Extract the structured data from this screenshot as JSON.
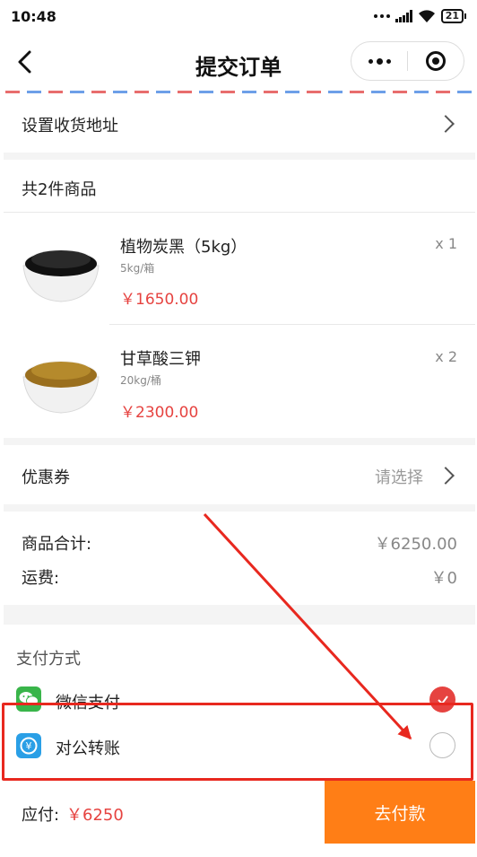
{
  "status_bar": {
    "time": "10:48",
    "battery": "21"
  },
  "navbar": {
    "title": "提交订单"
  },
  "address": {
    "label": "设置收货地址"
  },
  "items_header": {
    "label": "共2件商品"
  },
  "items": [
    {
      "name": "植物炭黑（5kg）",
      "spec": "5kg/箱",
      "price": "￥1650.00",
      "qty": "x 1"
    },
    {
      "name": "甘草酸三钾",
      "spec": "20kg/桶",
      "price": "￥2300.00",
      "qty": "x 2"
    }
  ],
  "coupon": {
    "label": "优惠券",
    "placeholder": "请选择"
  },
  "summary": {
    "goods_label": "商品合计:",
    "goods_value": "￥6250.00",
    "shipping_label": "运费:",
    "shipping_value": "￥0"
  },
  "payment": {
    "heading": "支付方式",
    "methods": [
      {
        "label": "微信支付",
        "selected": true
      },
      {
        "label": "对公转账",
        "selected": false
      }
    ]
  },
  "footer": {
    "due_label": "应付:",
    "due_value": "￥6250",
    "pay_button": "去付款"
  },
  "colors": {
    "accent": "#ff7e16",
    "price": "#e64340",
    "wechat": "#39b54a",
    "transfer": "#2a9fe6",
    "annotation": "#e8281f"
  }
}
